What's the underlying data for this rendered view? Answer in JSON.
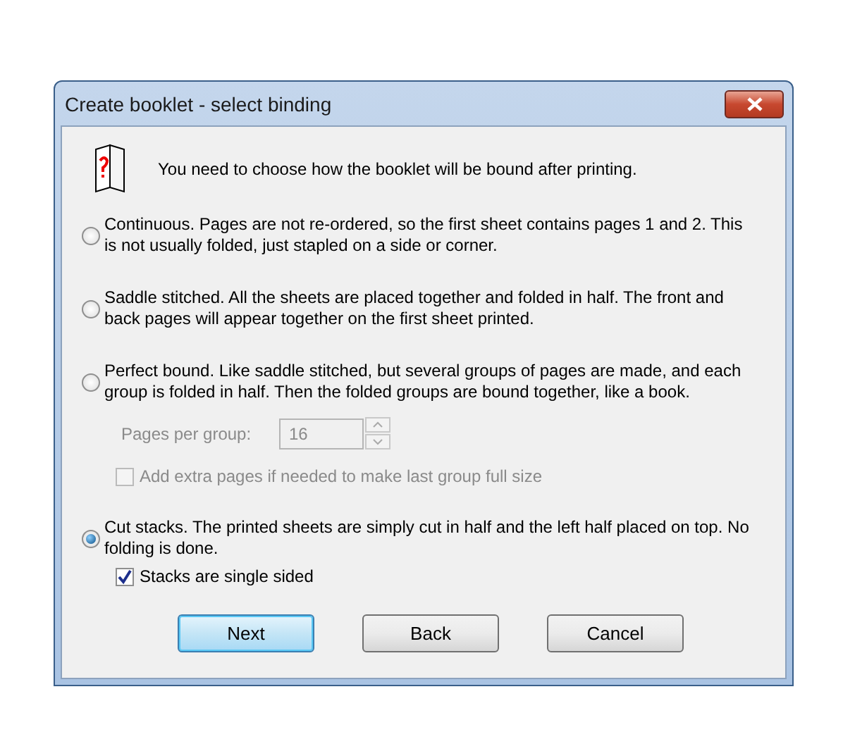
{
  "window": {
    "title": "Create booklet - select binding"
  },
  "intro": "You need to choose how the booklet will be bound after printing.",
  "options": [
    {
      "label": "Continuous. Pages are not re-ordered, so the first sheet contains pages 1 and 2. This is not usually folded, just stapled on a side or corner.",
      "selected": false
    },
    {
      "label": "Saddle stitched. All the sheets are placed together and folded in half. The front and back pages will appear together on the first sheet printed.",
      "selected": false
    },
    {
      "label": "Perfect bound. Like saddle stitched, but several groups of pages are made, and each group is folded in half. Then the folded groups are bound together, like a book.",
      "selected": false,
      "controls": [
        {
          "kind": "spinner",
          "label": "Pages per group:",
          "value": "16",
          "disabled": true
        },
        {
          "kind": "checkbox",
          "label": "Add extra pages if needed to make last group full size",
          "checked": false,
          "disabled": true
        }
      ]
    },
    {
      "label": "Cut stacks. The printed sheets are simply cut in half and the left half placed on top. No folding is done.",
      "selected": true,
      "controls": [
        {
          "kind": "checkbox",
          "label": "Stacks are single sided",
          "checked": true,
          "disabled": false
        }
      ]
    }
  ],
  "buttons": [
    {
      "label": "Next",
      "default": true
    },
    {
      "label": "Back",
      "default": false
    },
    {
      "label": "Cancel",
      "default": false
    }
  ]
}
